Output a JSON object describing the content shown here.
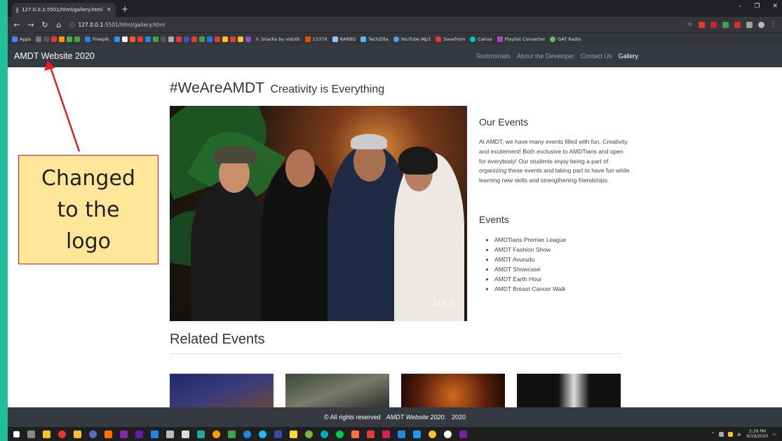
{
  "browser": {
    "tab_title": "127.0.0.1:5501/html/gallery.html",
    "url_host": "127.0.0.1",
    "url_rest": ":5501/html/gallery.html",
    "bookmarks": [
      "Apps",
      "Freepik",
      "Snacks by viduth",
      "1337X",
      "RARBG",
      "TechZilla",
      "YouTube Mp3",
      "Savefrom",
      "Canva",
      "Playlist Converter",
      "GAT Radio"
    ]
  },
  "site": {
    "brand": "AMDT Website 2020",
    "nav": [
      "Testimonials",
      "About the Developer",
      "Contact Us",
      "Gallery"
    ],
    "active_nav": "Gallery"
  },
  "main": {
    "heading_big": "#WeAreAMDT",
    "heading_small": "Creativity is Everything",
    "photo_watermark": "AMDT",
    "our_events_title": "Our Events",
    "our_events_text": "At AMDT, we have many events filled with fun, Creativity and excitement! Both exclusive to AMDTians and open for everybody! Our students enjoy being a part of organizing these events and taking part to have fun while learning new skills and strengthening friendships.",
    "events_title": "Events",
    "events": [
      "AMDTians Premier League",
      "AMDT Fashion Show",
      "AMDT Avurudu",
      "AMDT Showcase",
      "AMDT Earth Hour",
      "AMDT Breast Cancer Walk"
    ],
    "related_title": "Related Events"
  },
  "footer": {
    "prefix": "© All rights reserved",
    "site": "AMDT Website 2020.",
    "year": "2020"
  },
  "taskbar": {
    "time": "2:29 PM",
    "date": "6/19/2020"
  },
  "annotation": {
    "lines": [
      "Changed",
      "to the",
      "logo"
    ]
  },
  "colors": {
    "desktop": "#1fbf9c",
    "navbar": "#343a40",
    "annotation_fill": "#ffe699",
    "annotation_border": "#e02020"
  }
}
